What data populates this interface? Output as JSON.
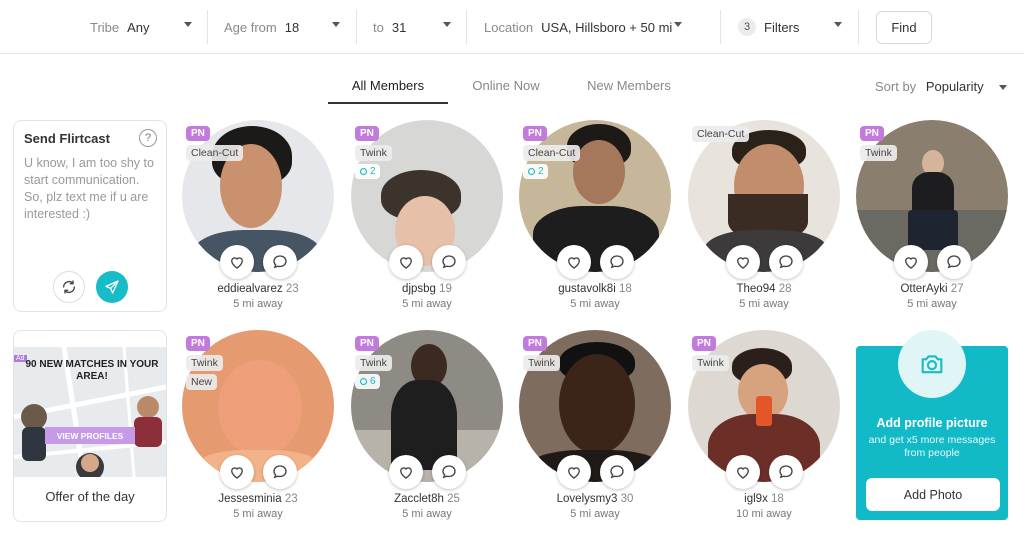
{
  "filters": {
    "tribe": {
      "label": "Tribe",
      "value": "Any"
    },
    "age_from": {
      "label": "Age from",
      "value": "18"
    },
    "age_to": {
      "label": "to",
      "value": "31"
    },
    "location": {
      "label": "Location",
      "value": "USA, Hillsboro + 50 mi"
    },
    "filters": {
      "count": "3",
      "label": "Filters"
    },
    "find_label": "Find"
  },
  "tabs": [
    "All Members",
    "Online Now",
    "New Members"
  ],
  "sort": {
    "label": "Sort by",
    "value": "Popularity"
  },
  "flirtcast": {
    "title": "Send Flirtcast",
    "help": "?",
    "message": "U know, I am too shy to start communication. So, plz text me if u are interested :)"
  },
  "offer": {
    "ad": "Ad",
    "headline": "90 NEW MATCHES IN YOUR AREA!",
    "button": "VIEW PROFILES",
    "caption": "Offer of the day"
  },
  "members": [
    {
      "name": "eddiealvarez",
      "age": "23",
      "distance": "5 mi away",
      "pn": "PN",
      "tags": [
        "Clean-Cut"
      ],
      "videos": ""
    },
    {
      "name": "djpsbg",
      "age": "19",
      "distance": "5 mi away",
      "pn": "PN",
      "tags": [
        "Twink"
      ],
      "videos": "2"
    },
    {
      "name": "gustavolk8i",
      "age": "18",
      "distance": "5 mi away",
      "pn": "PN",
      "tags": [
        "Clean-Cut"
      ],
      "videos": "2"
    },
    {
      "name": "Theo94",
      "age": "28",
      "distance": "5 mi away",
      "pn": "",
      "tags": [
        "Clean-Cut"
      ],
      "videos": ""
    },
    {
      "name": "OtterAyki",
      "age": "27",
      "distance": "5 mi away",
      "pn": "PN",
      "tags": [
        "Twink"
      ],
      "videos": ""
    },
    {
      "name": "Jessesminia",
      "age": "23",
      "distance": "5 mi away",
      "pn": "PN",
      "tags": [
        "Twink",
        "New"
      ],
      "videos": ""
    },
    {
      "name": "Zacclet8h",
      "age": "25",
      "distance": "5 mi away",
      "pn": "PN",
      "tags": [
        "Twink"
      ],
      "videos": "6"
    },
    {
      "name": "Lovelysmy3",
      "age": "30",
      "distance": "5 mi away",
      "pn": "PN",
      "tags": [
        "Twink"
      ],
      "videos": ""
    },
    {
      "name": "igl9x",
      "age": "18",
      "distance": "10 mi away",
      "pn": "PN",
      "tags": [
        "Twink"
      ],
      "videos": ""
    }
  ],
  "promo": {
    "title": "Add profile picture",
    "subtitle": "and get x5 more messages from people",
    "button": "Add Photo"
  },
  "colors": {
    "accent": "#16bcc8",
    "pn_badge": "#c27bdc"
  },
  "icons": {
    "like": "heart-icon",
    "message": "chat-bubble-icon",
    "refresh": "refresh-icon",
    "send": "paper-plane-icon",
    "camera": "camera-icon",
    "video": "video-icon"
  }
}
